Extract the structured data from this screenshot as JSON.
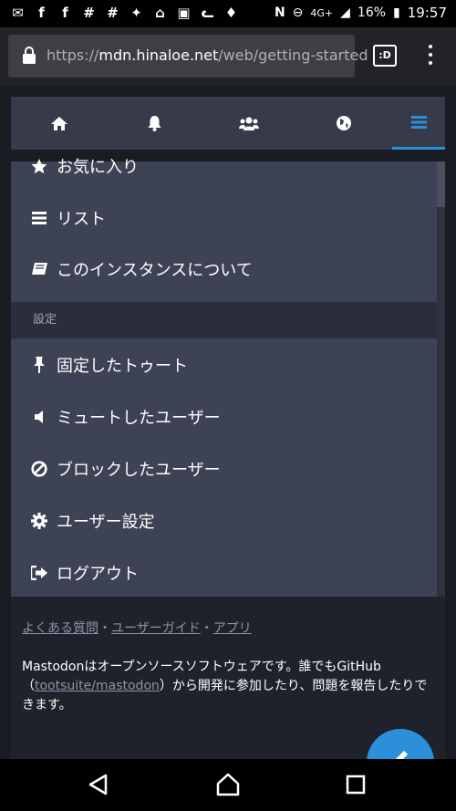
{
  "status_bar": {
    "notification_icons": [
      "mail-icon",
      "facebook-icon",
      "facebook-icon",
      "hashtag-icon",
      "slack-icon",
      "bird-icon",
      "home-icon",
      "photo-icon",
      "cat-icon",
      "twitter-icon"
    ],
    "network": "4G+",
    "battery": "16%",
    "time": "19:57"
  },
  "browser": {
    "url_domain": "mdn.hinaloe.net",
    "url_prefix": "https://",
    "url_path": "/web/getting-started",
    "tabs_label": ":D"
  },
  "nav_tabs": [
    {
      "name": "home"
    },
    {
      "name": "notifications"
    },
    {
      "name": "local"
    },
    {
      "name": "federated"
    },
    {
      "name": "menu",
      "active": true
    }
  ],
  "menu": {
    "items": [
      {
        "label": "お気に入り",
        "icon": "star-icon"
      },
      {
        "label": "リスト",
        "icon": "list-icon"
      },
      {
        "label": "このインスタンスについて",
        "icon": "book-icon"
      }
    ],
    "section_label": "設定",
    "settings_items": [
      {
        "label": "固定したトゥート",
        "icon": "pin-icon"
      },
      {
        "label": "ミュートしたユーザー",
        "icon": "volume-off-icon"
      },
      {
        "label": "ブロックしたユーザー",
        "icon": "ban-icon"
      },
      {
        "label": "ユーザー設定",
        "icon": "gear-icon"
      },
      {
        "label": "ログアウト",
        "icon": "sign-out-icon"
      }
    ]
  },
  "footer": {
    "links": [
      "よくある質問",
      "ユーザーガイド",
      "アプリ"
    ],
    "separator": "・",
    "about_before": "Mastodonはオープンソースソフトウェアです。誰でもGitHub（",
    "about_link": "tootsuite/mastodon",
    "about_after": "）から開発に参加したり、問題を報告したりできます。"
  },
  "colors": {
    "accent": "#2b90d9",
    "menu_bg": "#3e4255",
    "page_bg": "#1a1c24"
  }
}
